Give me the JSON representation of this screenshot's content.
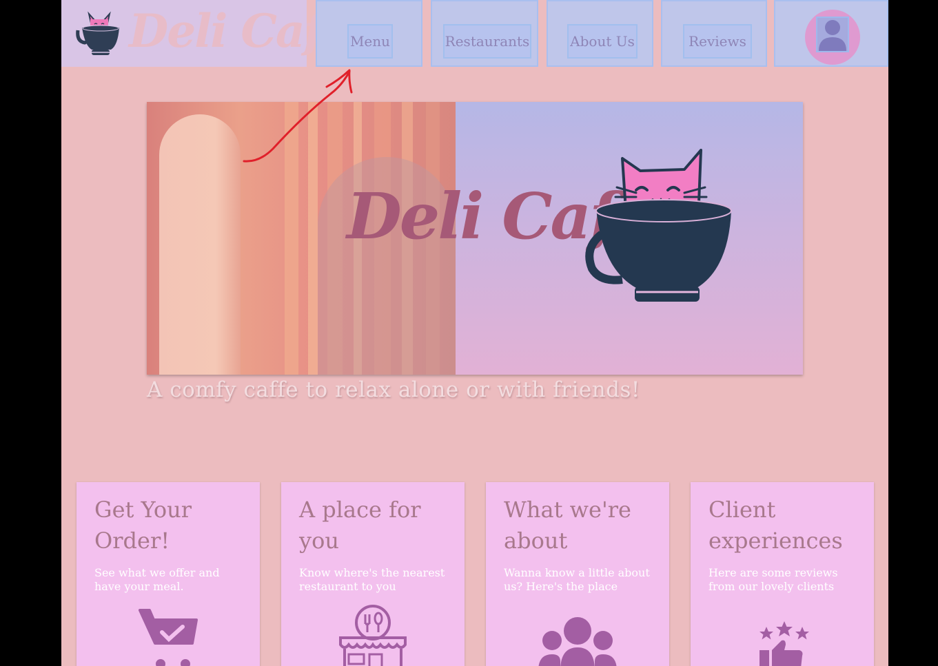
{
  "header": {
    "brand_name": "Deli Caffe",
    "nav": [
      {
        "label": "Menu"
      },
      {
        "label": "Restaurants"
      },
      {
        "label": "About Us"
      },
      {
        "label": "Reviews"
      }
    ]
  },
  "hero": {
    "title": "Deli Caffe",
    "tagline": "A comfy caffe to relax alone or with friends!"
  },
  "cards": [
    {
      "title": "Get Your Order!",
      "text": "See what we offer and have your meal.",
      "icon": "shopping-cart-icon"
    },
    {
      "title": "A place for you",
      "text": "Know where's the nearest restaurant to you",
      "icon": "storefront-icon"
    },
    {
      "title": "What we're about",
      "text": "Wanna know a little about us? Here's the place",
      "icon": "group-icon"
    },
    {
      "title": "Client experiences",
      "text": "Here are some reviews from our lovely clients",
      "icon": "rating-thumbs-up-icon"
    }
  ],
  "colors": {
    "page_bg": "#ecbcbf",
    "nav_bg": "#bfc6ea",
    "card_bg": "#f3c0ee",
    "accent": "#a65977",
    "annotation": "#e0202a"
  }
}
